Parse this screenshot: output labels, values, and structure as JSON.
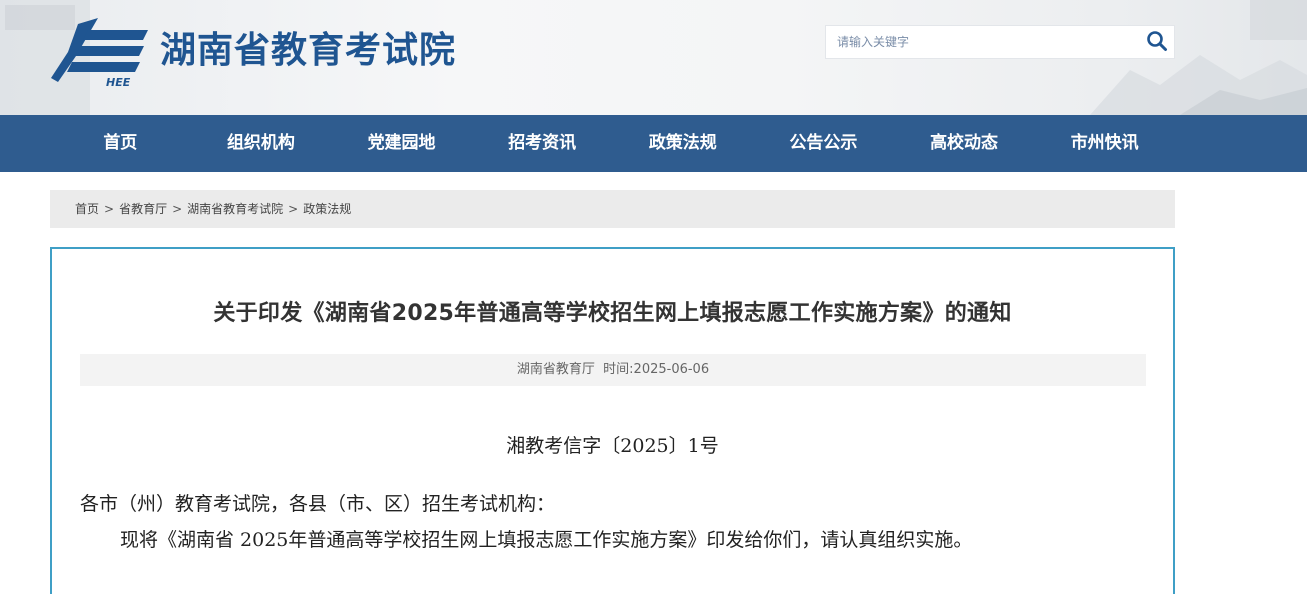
{
  "header": {
    "site_title": "湖南省教育考试院",
    "logo_caption": "HEE",
    "search": {
      "placeholder": "请输入关键字",
      "value": ""
    }
  },
  "nav": {
    "items": [
      {
        "label": "首页"
      },
      {
        "label": "组织机构"
      },
      {
        "label": "党建园地"
      },
      {
        "label": "招考资讯"
      },
      {
        "label": "政策法规"
      },
      {
        "label": "公告公示"
      },
      {
        "label": "高校动态"
      },
      {
        "label": "市州快讯"
      }
    ]
  },
  "breadcrumb": {
    "items": [
      {
        "label": "首页"
      },
      {
        "label": "省教育厅"
      },
      {
        "label": "湖南省教育考试院"
      },
      {
        "label": "政策法规"
      }
    ],
    "separator": ">"
  },
  "article": {
    "title": "关于印发《湖南省2025年普通高等学校招生网上填报志愿工作实施方案》的通知",
    "source": "湖南省教育厅",
    "date_label": "时间:",
    "date": "2025-06-06",
    "doc_number": "湘教考信字〔2025〕1号",
    "salutation": "各市（州）教育考试院，各县（市、区）招生考试机构：",
    "paragraph": "现将《湖南省 2025年普通高等学校招生网上填报志愿工作实施方案》印发给你们，请认真组织实施。"
  },
  "colors": {
    "brand_blue": "#1f5591",
    "nav_bg": "#2f5c8f",
    "article_border": "#3f9fc6",
    "breadcrumb_bg": "#ebebeb"
  },
  "icons": {
    "search": "search-icon",
    "logo": "hee-logo-icon"
  }
}
